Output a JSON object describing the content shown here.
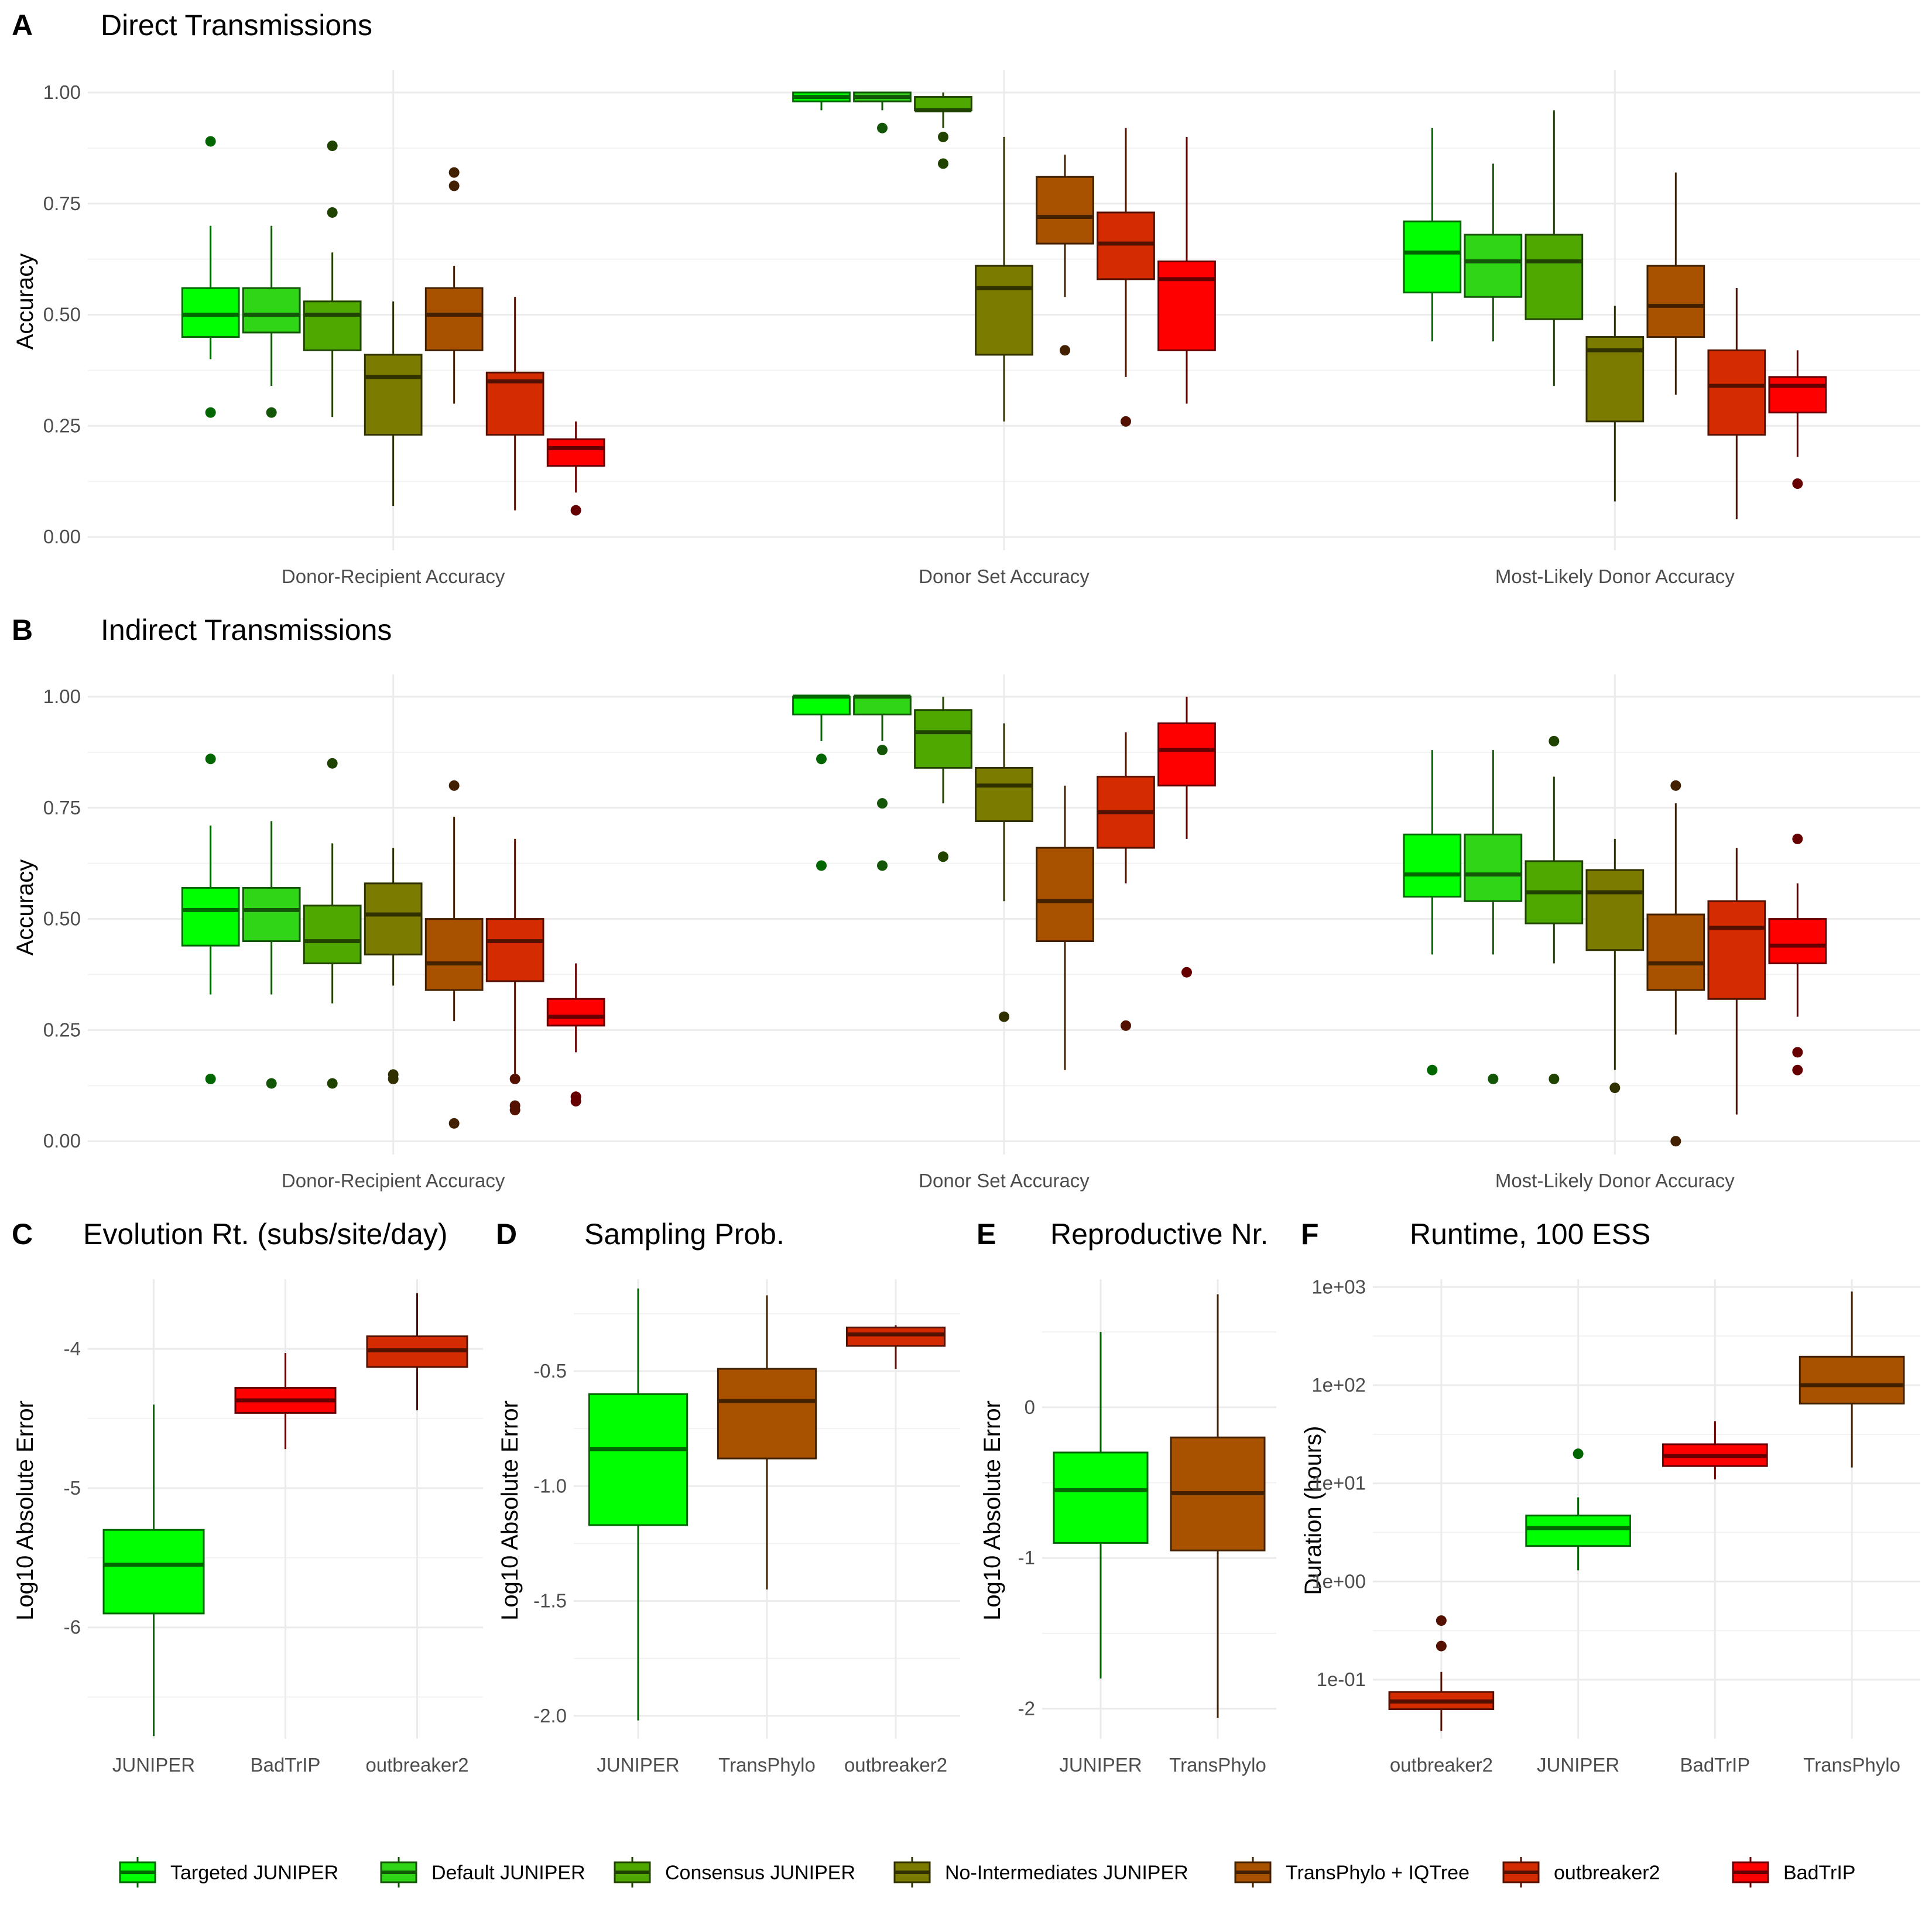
{
  "colors": {
    "Targeted JUNIPER": "#00ff00",
    "Default JUNIPER": "#2fd615",
    "Consensus JUNIPER": "#4fa800",
    "No-Intermediates JUNIPER": "#7b7b00",
    "TransPhylo + IQTree": "#a85200",
    "outbreaker2": "#d42b00",
    "BadTrIP": "#ff0000"
  },
  "legend": [
    "Targeted JUNIPER",
    "Default JUNIPER",
    "Consensus JUNIPER",
    "No-Intermediates JUNIPER",
    "TransPhylo + IQTree",
    "outbreaker2",
    "BadTrIP"
  ],
  "panels": {
    "A": {
      "letter": "A",
      "title": "Direct Transmissions",
      "ylabel": "Accuracy"
    },
    "B": {
      "letter": "B",
      "title": "Indirect Transmissions",
      "ylabel": "Accuracy"
    },
    "C": {
      "letter": "C",
      "title": "Evolution Rt. (subs/site/day)",
      "ylabel": "Log10 Absolute Error"
    },
    "D": {
      "letter": "D",
      "title": "Sampling Prob.",
      "ylabel": "Log10 Absolute Error"
    },
    "E": {
      "letter": "E",
      "title": "Reproductive Nr.",
      "ylabel": "Log10 Absolute Error"
    },
    "F": {
      "letter": "F",
      "title": "Runtime, 100 ESS",
      "ylabel": "Duration (hours)"
    }
  },
  "chart_data": [
    {
      "id": "A",
      "type": "box",
      "title": "Direct Transmissions",
      "ylabel": "Accuracy",
      "ylim": [
        -0.03,
        1.05
      ],
      "yticks": [
        0,
        0.25,
        0.5,
        0.75,
        1.0
      ],
      "ytick_labels": [
        "0.00",
        "0.25",
        "0.50",
        "0.75",
        "1.00"
      ],
      "categories": [
        "Donor-Recipient Accuracy",
        "Donor Set Accuracy",
        "Most-Likely Donor Accuracy"
      ],
      "groups": [
        [
          {
            "method": "Targeted JUNIPER",
            "q1": 0.45,
            "median": 0.5,
            "q3": 0.56,
            "wlo": 0.4,
            "whi": 0.7,
            "out": [
              0.89,
              0.28
            ]
          },
          {
            "method": "Default JUNIPER",
            "q1": 0.46,
            "median": 0.5,
            "q3": 0.56,
            "wlo": 0.34,
            "whi": 0.7,
            "out": [
              0.28
            ]
          },
          {
            "method": "Consensus JUNIPER",
            "q1": 0.42,
            "median": 0.5,
            "q3": 0.53,
            "wlo": 0.27,
            "whi": 0.64,
            "out": [
              0.88,
              0.73
            ]
          },
          {
            "method": "No-Intermediates JUNIPER",
            "q1": 0.23,
            "median": 0.36,
            "q3": 0.41,
            "wlo": 0.07,
            "whi": 0.53,
            "out": []
          },
          {
            "method": "TransPhylo + IQTree",
            "q1": 0.42,
            "median": 0.5,
            "q3": 0.56,
            "wlo": 0.3,
            "whi": 0.61,
            "out": [
              0.82,
              0.79
            ]
          },
          {
            "method": "outbreaker2",
            "q1": 0.23,
            "median": 0.35,
            "q3": 0.37,
            "wlo": 0.06,
            "whi": 0.54,
            "out": []
          },
          {
            "method": "BadTrIP",
            "q1": 0.16,
            "median": 0.2,
            "q3": 0.22,
            "wlo": 0.1,
            "whi": 0.26,
            "out": [
              0.06
            ]
          }
        ],
        [
          {
            "method": "Targeted JUNIPER",
            "q1": 0.98,
            "median": 0.99,
            "q3": 1.0,
            "wlo": 0.96,
            "whi": 1.0,
            "out": []
          },
          {
            "method": "Default JUNIPER",
            "q1": 0.98,
            "median": 0.99,
            "q3": 1.0,
            "wlo": 0.96,
            "whi": 1.0,
            "out": [
              0.92
            ]
          },
          {
            "method": "Consensus JUNIPER",
            "q1": 0.96,
            "median": 0.96,
            "q3": 0.99,
            "wlo": 0.92,
            "whi": 1.0,
            "out": [
              0.9,
              0.84
            ]
          },
          {
            "method": "No-Intermediates JUNIPER",
            "q1": 0.41,
            "median": 0.56,
            "q3": 0.61,
            "wlo": 0.26,
            "whi": 0.9,
            "out": []
          },
          {
            "method": "TransPhylo + IQTree",
            "q1": 0.66,
            "median": 0.72,
            "q3": 0.81,
            "wlo": 0.54,
            "whi": 0.86,
            "out": [
              0.42
            ]
          },
          {
            "method": "outbreaker2",
            "q1": 0.58,
            "median": 0.66,
            "q3": 0.73,
            "wlo": 0.36,
            "whi": 0.92,
            "out": [
              0.26
            ]
          },
          {
            "method": "BadTrIP",
            "q1": 0.42,
            "median": 0.58,
            "q3": 0.62,
            "wlo": 0.3,
            "whi": 0.9,
            "out": []
          }
        ],
        [
          {
            "method": "Targeted JUNIPER",
            "q1": 0.55,
            "median": 0.64,
            "q3": 0.71,
            "wlo": 0.44,
            "whi": 0.92,
            "out": []
          },
          {
            "method": "Default JUNIPER",
            "q1": 0.54,
            "median": 0.62,
            "q3": 0.68,
            "wlo": 0.44,
            "whi": 0.84,
            "out": []
          },
          {
            "method": "Consensus JUNIPER",
            "q1": 0.49,
            "median": 0.62,
            "q3": 0.68,
            "wlo": 0.34,
            "whi": 0.96,
            "out": []
          },
          {
            "method": "No-Intermediates JUNIPER",
            "q1": 0.26,
            "median": 0.42,
            "q3": 0.45,
            "wlo": 0.08,
            "whi": 0.52,
            "out": []
          },
          {
            "method": "TransPhylo + IQTree",
            "q1": 0.45,
            "median": 0.52,
            "q3": 0.61,
            "wlo": 0.32,
            "whi": 0.82,
            "out": []
          },
          {
            "method": "outbreaker2",
            "q1": 0.23,
            "median": 0.34,
            "q3": 0.42,
            "wlo": 0.04,
            "whi": 0.56,
            "out": []
          },
          {
            "method": "BadTrIP",
            "q1": 0.28,
            "median": 0.34,
            "q3": 0.36,
            "wlo": 0.18,
            "whi": 0.42,
            "out": [
              0.12
            ]
          }
        ]
      ]
    },
    {
      "id": "B",
      "type": "box",
      "title": "Indirect Transmissions",
      "ylabel": "Accuracy",
      "ylim": [
        -0.03,
        1.05
      ],
      "yticks": [
        0,
        0.25,
        0.5,
        0.75,
        1.0
      ],
      "ytick_labels": [
        "0.00",
        "0.25",
        "0.50",
        "0.75",
        "1.00"
      ],
      "categories": [
        "Donor-Recipient Accuracy",
        "Donor Set Accuracy",
        "Most-Likely Donor Accuracy"
      ],
      "groups": [
        [
          {
            "method": "Targeted JUNIPER",
            "q1": 0.44,
            "median": 0.52,
            "q3": 0.57,
            "wlo": 0.33,
            "whi": 0.71,
            "out": [
              0.86,
              0.14
            ]
          },
          {
            "method": "Default JUNIPER",
            "q1": 0.45,
            "median": 0.52,
            "q3": 0.57,
            "wlo": 0.33,
            "whi": 0.72,
            "out": [
              0.13
            ]
          },
          {
            "method": "Consensus JUNIPER",
            "q1": 0.4,
            "median": 0.45,
            "q3": 0.53,
            "wlo": 0.31,
            "whi": 0.67,
            "out": [
              0.85,
              0.13
            ]
          },
          {
            "method": "No-Intermediates JUNIPER",
            "q1": 0.42,
            "median": 0.51,
            "q3": 0.58,
            "wlo": 0.35,
            "whi": 0.66,
            "out": [
              0.15,
              0.14
            ]
          },
          {
            "method": "TransPhylo + IQTree",
            "q1": 0.34,
            "median": 0.4,
            "q3": 0.5,
            "wlo": 0.27,
            "whi": 0.73,
            "out": [
              0.8,
              0.04
            ]
          },
          {
            "method": "outbreaker2",
            "q1": 0.36,
            "median": 0.45,
            "q3": 0.5,
            "wlo": 0.15,
            "whi": 0.68,
            "out": [
              0.14,
              0.08,
              0.07
            ]
          },
          {
            "method": "BadTrIP",
            "q1": 0.26,
            "median": 0.28,
            "q3": 0.32,
            "wlo": 0.2,
            "whi": 0.4,
            "out": [
              0.1,
              0.09
            ]
          }
        ],
        [
          {
            "method": "Targeted JUNIPER",
            "q1": 0.96,
            "median": 1.0,
            "q3": 1.0,
            "wlo": 0.9,
            "whi": 1.0,
            "out": [
              0.86,
              0.62
            ]
          },
          {
            "method": "Default JUNIPER",
            "q1": 0.96,
            "median": 1.0,
            "q3": 1.0,
            "wlo": 0.9,
            "whi": 1.0,
            "out": [
              0.88,
              0.76,
              0.62
            ]
          },
          {
            "method": "Consensus JUNIPER",
            "q1": 0.84,
            "median": 0.92,
            "q3": 0.97,
            "wlo": 0.76,
            "whi": 1.0,
            "out": [
              0.64
            ]
          },
          {
            "method": "No-Intermediates JUNIPER",
            "q1": 0.72,
            "median": 0.8,
            "q3": 0.84,
            "wlo": 0.54,
            "whi": 0.94,
            "out": [
              0.28
            ]
          },
          {
            "method": "TransPhylo + IQTree",
            "q1": 0.45,
            "median": 0.54,
            "q3": 0.66,
            "wlo": 0.16,
            "whi": 0.8,
            "out": []
          },
          {
            "method": "outbreaker2",
            "q1": 0.66,
            "median": 0.74,
            "q3": 0.82,
            "wlo": 0.58,
            "whi": 0.92,
            "out": [
              0.26
            ]
          },
          {
            "method": "BadTrIP",
            "q1": 0.8,
            "median": 0.88,
            "q3": 0.94,
            "wlo": 0.68,
            "whi": 1.0,
            "out": [
              0.38
            ]
          }
        ],
        [
          {
            "method": "Targeted JUNIPER",
            "q1": 0.55,
            "median": 0.6,
            "q3": 0.69,
            "wlo": 0.42,
            "whi": 0.88,
            "out": [
              0.16
            ]
          },
          {
            "method": "Default JUNIPER",
            "q1": 0.54,
            "median": 0.6,
            "q3": 0.69,
            "wlo": 0.42,
            "whi": 0.88,
            "out": [
              0.14
            ]
          },
          {
            "method": "Consensus JUNIPER",
            "q1": 0.49,
            "median": 0.56,
            "q3": 0.63,
            "wlo": 0.4,
            "whi": 0.82,
            "out": [
              0.9,
              0.14
            ]
          },
          {
            "method": "No-Intermediates JUNIPER",
            "q1": 0.43,
            "median": 0.56,
            "q3": 0.61,
            "wlo": 0.16,
            "whi": 0.68,
            "out": [
              0.12
            ]
          },
          {
            "method": "TransPhylo + IQTree",
            "q1": 0.34,
            "median": 0.4,
            "q3": 0.51,
            "wlo": 0.24,
            "whi": 0.76,
            "out": [
              0.8,
              0.0
            ]
          },
          {
            "method": "outbreaker2",
            "q1": 0.32,
            "median": 0.48,
            "q3": 0.54,
            "wlo": 0.06,
            "whi": 0.66,
            "out": []
          },
          {
            "method": "BadTrIP",
            "q1": 0.4,
            "median": 0.44,
            "q3": 0.5,
            "wlo": 0.28,
            "whi": 0.58,
            "out": [
              0.68,
              0.2,
              0.16
            ]
          }
        ]
      ]
    },
    {
      "id": "C",
      "type": "box",
      "title": "Evolution Rt. (subs/site/day)",
      "ylabel": "Log10 Absolute Error",
      "ylim": [
        -6.8,
        -3.5
      ],
      "yticks": [
        -6,
        -5,
        -4
      ],
      "ytick_labels": [
        "-6",
        "-5",
        "-4"
      ],
      "categories": [
        "JUNIPER",
        "BadTrIP",
        "outbreaker2"
      ],
      "boxes": [
        {
          "method": "Targeted JUNIPER",
          "q1": -5.9,
          "median": -5.55,
          "q3": -5.3,
          "wlo": -6.78,
          "whi": -4.4,
          "out": []
        },
        {
          "method": "BadTrIP",
          "q1": -4.46,
          "median": -4.37,
          "q3": -4.28,
          "wlo": -4.72,
          "whi": -4.03,
          "out": []
        },
        {
          "method": "outbreaker2",
          "q1": -4.13,
          "median": -4.01,
          "q3": -3.91,
          "wlo": -4.44,
          "whi": -3.6,
          "out": []
        }
      ]
    },
    {
      "id": "D",
      "type": "box",
      "title": "Sampling Prob.",
      "ylabel": "Log10 Absolute Error",
      "ylim": [
        -2.1,
        -0.1
      ],
      "yticks": [
        -2.0,
        -1.5,
        -1.0,
        -0.5
      ],
      "ytick_labels": [
        "-2.0",
        "-1.5",
        "-1.0",
        "-0.5"
      ],
      "categories": [
        "JUNIPER",
        "TransPhylo",
        "outbreaker2"
      ],
      "boxes": [
        {
          "method": "Targeted JUNIPER",
          "q1": -1.17,
          "median": -0.84,
          "q3": -0.6,
          "wlo": -2.02,
          "whi": -0.14,
          "out": []
        },
        {
          "method": "TransPhylo + IQTree",
          "q1": -0.88,
          "median": -0.63,
          "q3": -0.49,
          "wlo": -1.45,
          "whi": -0.17,
          "out": []
        },
        {
          "method": "outbreaker2",
          "q1": -0.39,
          "median": -0.34,
          "q3": -0.31,
          "wlo": -0.49,
          "whi": -0.3,
          "out": []
        }
      ]
    },
    {
      "id": "E",
      "type": "box",
      "title": "Reproductive Nr.",
      "ylabel": "Log10 Absolute Error",
      "ylim": [
        -2.2,
        0.85
      ],
      "yticks": [
        -2,
        -1,
        0
      ],
      "ytick_labels": [
        "-2",
        "-1",
        "0"
      ],
      "categories": [
        "JUNIPER",
        "TransPhylo"
      ],
      "boxes": [
        {
          "method": "Targeted JUNIPER",
          "q1": -0.9,
          "median": -0.55,
          "q3": -0.3,
          "wlo": -1.8,
          "whi": 0.5,
          "out": []
        },
        {
          "method": "TransPhylo + IQTree",
          "q1": -0.95,
          "median": -0.57,
          "q3": -0.2,
          "wlo": -2.06,
          "whi": 0.75,
          "out": []
        }
      ]
    },
    {
      "id": "F",
      "type": "box",
      "title": "Runtime, 100 ESS",
      "ylabel": "Duration (hours)",
      "yscale": "log10",
      "ylim": [
        0.025,
        1200
      ],
      "yticks": [
        0.1,
        1,
        10,
        100,
        1000
      ],
      "ytick_labels": [
        "1e-01",
        "1e+00",
        "1e+01",
        "1e+02",
        "1e+03"
      ],
      "categories": [
        "outbreaker2",
        "JUNIPER",
        "BadTrIP",
        "TransPhylo"
      ],
      "boxes": [
        {
          "method": "outbreaker2",
          "q1": 0.05,
          "median": 0.06,
          "q3": 0.075,
          "wlo": 0.03,
          "whi": 0.12,
          "out": [
            0.4,
            0.22
          ]
        },
        {
          "method": "Targeted JUNIPER",
          "q1": 2.3,
          "median": 3.5,
          "q3": 4.7,
          "wlo": 1.3,
          "whi": 7.2,
          "out": [
            20
          ]
        },
        {
          "method": "BadTrIP",
          "q1": 15,
          "median": 19,
          "q3": 25,
          "wlo": 11,
          "whi": 43,
          "out": []
        },
        {
          "method": "TransPhylo + IQTree",
          "q1": 65,
          "median": 100,
          "q3": 195,
          "wlo": 14.5,
          "whi": 900,
          "out": []
        }
      ]
    }
  ]
}
